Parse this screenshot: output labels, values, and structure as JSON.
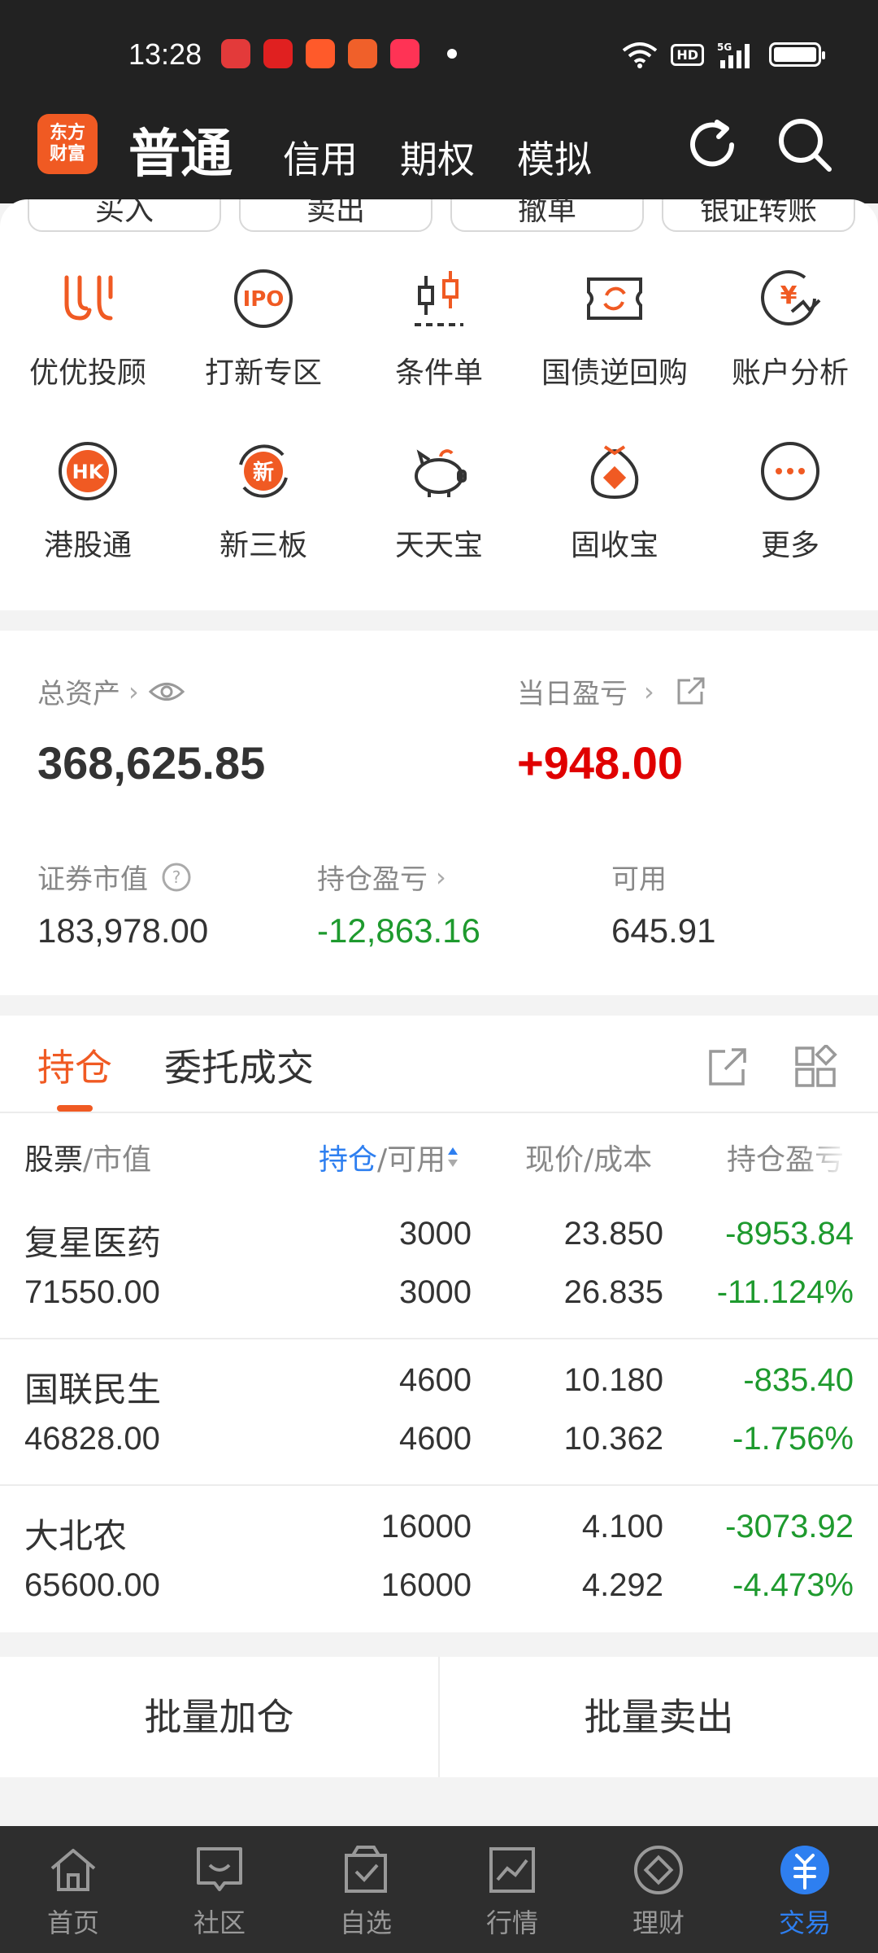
{
  "status": {
    "time": "13:28",
    "network": "5G"
  },
  "header": {
    "logo": [
      "东方",
      "财富"
    ],
    "tabs": [
      "普通",
      "信用",
      "期权",
      "模拟"
    ],
    "active_tab": "普通"
  },
  "quick_actions": [
    "买入",
    "卖出",
    "撤单",
    "银证转账"
  ],
  "features": [
    {
      "label": "优优投顾",
      "icon": "uu-advisor-icon",
      "glyph": "UU"
    },
    {
      "label": "打新专区",
      "icon": "ipo-icon",
      "glyph": "IPO"
    },
    {
      "label": "条件单",
      "icon": "candlestick-icon",
      "glyph": ""
    },
    {
      "label": "国债逆回购",
      "icon": "bond-repo-icon",
      "glyph": ""
    },
    {
      "label": "账户分析",
      "icon": "yen-chart-icon",
      "glyph": "¥"
    },
    {
      "label": "港股通",
      "icon": "hk-icon",
      "glyph": "HK"
    },
    {
      "label": "新三板",
      "icon": "new-board-icon",
      "glyph": "新"
    },
    {
      "label": "天天宝",
      "icon": "piggy-bank-icon",
      "glyph": ""
    },
    {
      "label": "固收宝",
      "icon": "money-bag-icon",
      "glyph": ""
    },
    {
      "label": "更多",
      "icon": "more-icon",
      "glyph": "···"
    }
  ],
  "assets": {
    "total_label": "总资产",
    "total_value": "368,625.85",
    "daily_pl_label": "当日盈亏",
    "daily_pl_value": "+948.00",
    "market_value_label": "证券市值",
    "market_value": "183,978.00",
    "position_pl_label": "持仓盈亏",
    "position_pl_value": "-12,863.16",
    "available_label": "可用",
    "available_value": "645.91"
  },
  "positions": {
    "tabs": [
      "持仓",
      "委托成交"
    ],
    "header": {
      "stock": "股票",
      "market": "/市值",
      "hold": "持仓",
      "avail": "/可用",
      "price_cost": "现价/成本",
      "pl": "持仓盈亏"
    },
    "rows": [
      {
        "name": "复星医药",
        "market_value": "71550.00",
        "hold": "3000",
        "available": "3000",
        "price": "23.850",
        "cost": "26.835",
        "pl": "-8953.84",
        "pl_pct": "-11.124%"
      },
      {
        "name": "国联民生",
        "market_value": "46828.00",
        "hold": "4600",
        "available": "4600",
        "price": "10.180",
        "cost": "10.362",
        "pl": "-835.40",
        "pl_pct": "-1.756%"
      },
      {
        "name": "大北农",
        "market_value": "65600.00",
        "hold": "16000",
        "available": "16000",
        "price": "4.100",
        "cost": "4.292",
        "pl": "-3073.92",
        "pl_pct": "-4.473%"
      }
    ]
  },
  "batch": {
    "add": "批量加仓",
    "sell": "批量卖出"
  },
  "nav": [
    {
      "label": "首页",
      "icon": "home-icon"
    },
    {
      "label": "社区",
      "icon": "community-icon"
    },
    {
      "label": "自选",
      "icon": "watchlist-icon"
    },
    {
      "label": "行情",
      "icon": "market-icon"
    },
    {
      "label": "理财",
      "icon": "wealth-icon"
    },
    {
      "label": "交易",
      "icon": "trade-icon",
      "active": true
    }
  ],
  "colors": {
    "accent": "#f05a23",
    "up": "#e00000",
    "down": "#1e9a2e",
    "active": "#2e7ff0"
  }
}
